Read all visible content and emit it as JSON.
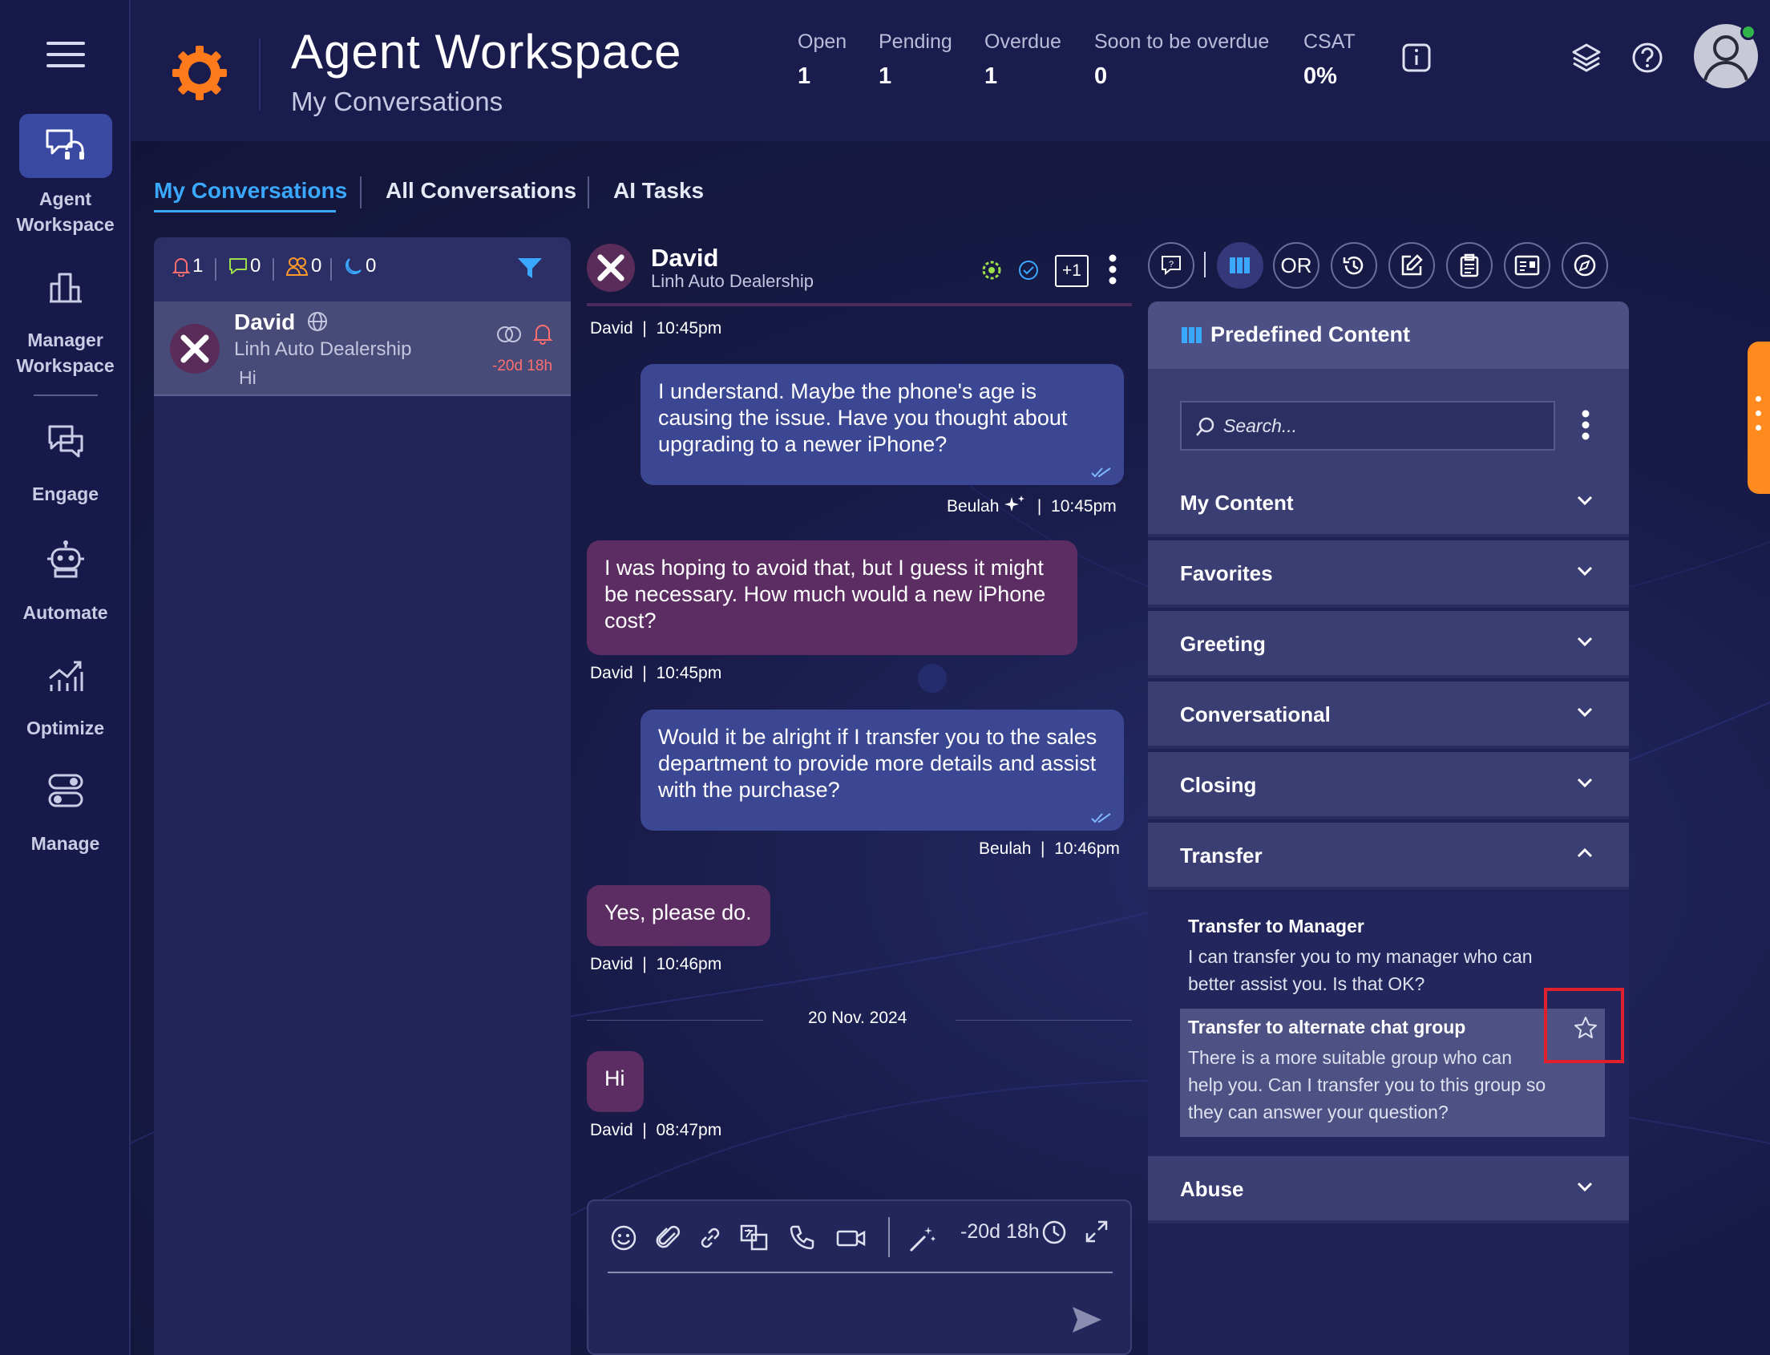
{
  "rail": {
    "items": [
      {
        "label_line1": "Agent",
        "label_line2": "Workspace",
        "icon": "headset-chat-icon"
      },
      {
        "label_line1": "Manager",
        "label_line2": "Workspace",
        "icon": "building-icon"
      },
      {
        "label_line1": "Engage",
        "label_line2": "",
        "icon": "chat-bubbles-icon"
      },
      {
        "label_line1": "Automate",
        "label_line2": "",
        "icon": "robot-icon"
      },
      {
        "label_line1": "Optimize",
        "label_line2": "",
        "icon": "chart-icon"
      },
      {
        "label_line1": "Manage",
        "label_line2": "",
        "icon": "toggles-icon"
      }
    ]
  },
  "header": {
    "title": "Agent Workspace",
    "subtitle": "My Conversations",
    "stats": [
      {
        "label": "Open",
        "value": "1"
      },
      {
        "label": "Pending",
        "value": "1"
      },
      {
        "label": "Overdue",
        "value": "1"
      },
      {
        "label": "Soon to be overdue",
        "value": "0"
      },
      {
        "label": "CSAT",
        "value": "0%"
      }
    ],
    "accent": "#ff7a1a"
  },
  "tabs": [
    {
      "label": "My Conversations",
      "active": true
    },
    {
      "label": "All Conversations",
      "active": false
    },
    {
      "label": "AI Tasks",
      "active": false
    }
  ],
  "list": {
    "counters": [
      "1",
      "0",
      "0",
      "0"
    ],
    "conversation": {
      "name": "David",
      "company": "Linh Auto Dealership",
      "preview": "Hi",
      "timer": "-20d 18h"
    }
  },
  "chat": {
    "name": "David",
    "company": "Linh Auto Dealership",
    "plus_badge": "+1",
    "messages": [
      {
        "dir": "meta-top",
        "author": "David",
        "time": "10:45pm"
      },
      {
        "dir": "out",
        "text": "I understand. Maybe the phone's age is causing the issue. Have you thought about upgrading to a newer iPhone?",
        "author": "Beulah",
        "time": "10:45pm"
      },
      {
        "dir": "in",
        "text": "I was hoping to avoid that, but I guess it might be necessary. How much would a new iPhone cost?",
        "author": "David",
        "time": "10:45pm"
      },
      {
        "dir": "out",
        "text": "Would it be alright if I transfer you to the sales department to provide more details and assist with the purchase?",
        "author": "Beulah",
        "time": "10:46pm"
      },
      {
        "dir": "in",
        "text": "Yes, please do.",
        "author": "David",
        "time": "10:46pm"
      },
      {
        "dir": "in",
        "text": "Hi",
        "author": "David",
        "time": "08:47pm"
      }
    ],
    "date_separator": "20 Nov. 2024",
    "composer_timer": "-20d 18h"
  },
  "panel": {
    "toolbar_or": "OR",
    "title": "Predefined Content",
    "search_placeholder": "Search...",
    "sections": [
      "My Content",
      "Favorites",
      "Greeting",
      "Conversational",
      "Closing",
      "Transfer",
      "Abuse"
    ],
    "transfer_items": [
      {
        "title": "Transfer to Manager",
        "line1": "I can transfer you to my manager who can",
        "line2": "better assist you. Is that OK?",
        "line3": ""
      },
      {
        "title": "Transfer to alternate chat group",
        "line1": "There is a more suitable group who can",
        "line2": "help you. Can I transfer you to this group so",
        "line3": "they can answer your question?"
      }
    ]
  },
  "colors": {
    "out_bubble": "#3b4793",
    "in_bubble": "#5c2d62",
    "active_tab": "#3aa8ff",
    "overdue": "#ff6f6f"
  }
}
